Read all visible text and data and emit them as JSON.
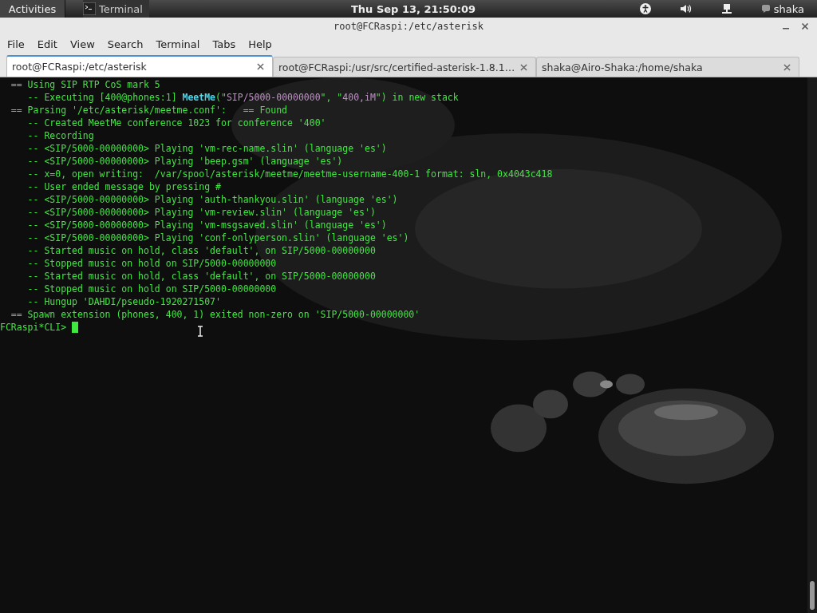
{
  "top_bar": {
    "activities": "Activities",
    "app": "Terminal",
    "clock": "Thu Sep 13, 21:50:09",
    "user": "shaka"
  },
  "window": {
    "title": "root@FCRaspi:/etc/asterisk"
  },
  "menu": [
    "File",
    "Edit",
    "View",
    "Search",
    "Terminal",
    "Tabs",
    "Help"
  ],
  "tabs": [
    {
      "label": "root@FCRaspi:/etc/asterisk",
      "selected": true
    },
    {
      "label": "root@FCRaspi:/usr/src/certified-asterisk-1.8.1…",
      "selected": false
    },
    {
      "label": "shaka@Airo-Shaka:/home/shaka",
      "selected": false
    }
  ],
  "terminal": {
    "lines": [
      [
        {
          "text": "  == Using SIP RTP CoS mark 5",
          "kind": "plain"
        }
      ],
      [
        {
          "text": "     -- Executing [400@phones:1] ",
          "kind": "plain"
        },
        {
          "text": "MeetMe",
          "kind": "function"
        },
        {
          "text": "(\"",
          "kind": "plain"
        },
        {
          "text": "SIP/5000-00000000",
          "kind": "string"
        },
        {
          "text": "\", \"",
          "kind": "plain"
        },
        {
          "text": "400,iM",
          "kind": "string"
        },
        {
          "text": "\") in new stack",
          "kind": "plain"
        }
      ],
      [
        {
          "text": "  == Parsing '/etc/asterisk/meetme.conf':   == Found",
          "kind": "plain"
        }
      ],
      [
        {
          "text": "     -- Created MeetMe conference 1023 for conference '400'",
          "kind": "plain"
        }
      ],
      [
        {
          "text": "     -- Recording",
          "kind": "plain"
        }
      ],
      [
        {
          "text": "     -- <SIP/5000-00000000> Playing 'vm-rec-name.slin' (language 'es')",
          "kind": "plain"
        }
      ],
      [
        {
          "text": "     -- <SIP/5000-00000000> Playing 'beep.gsm' (language 'es')",
          "kind": "plain"
        }
      ],
      [
        {
          "text": "     -- x=0, open writing:  /var/spool/asterisk/meetme/meetme-username-400-1 format: sln, 0x4043c418",
          "kind": "plain"
        }
      ],
      [
        {
          "text": "     -- User ended message by pressing #",
          "kind": "plain"
        }
      ],
      [
        {
          "text": "     -- <SIP/5000-00000000> Playing 'auth-thankyou.slin' (language 'es')",
          "kind": "plain"
        }
      ],
      [
        {
          "text": "     -- <SIP/5000-00000000> Playing 'vm-review.slin' (language 'es')",
          "kind": "plain"
        }
      ],
      [
        {
          "text": "     -- <SIP/5000-00000000> Playing 'vm-msgsaved.slin' (language 'es')",
          "kind": "plain"
        }
      ],
      [
        {
          "text": "     -- <SIP/5000-00000000> Playing 'conf-onlyperson.slin' (language 'es')",
          "kind": "plain"
        }
      ],
      [
        {
          "text": "     -- Started music on hold, class 'default', on SIP/5000-00000000",
          "kind": "plain"
        }
      ],
      [
        {
          "text": "     -- Stopped music on hold on SIP/5000-00000000",
          "kind": "plain"
        }
      ],
      [
        {
          "text": "     -- Started music on hold, class 'default', on SIP/5000-00000000",
          "kind": "plain"
        }
      ],
      [
        {
          "text": "     -- Stopped music on hold on SIP/5000-00000000",
          "kind": "plain"
        }
      ],
      [
        {
          "text": "     -- Hungup 'DAHDI/pseudo-1920271507'",
          "kind": "plain"
        }
      ],
      [
        {
          "text": "  == Spawn extension (phones, 400, 1) exited non-zero on 'SIP/5000-00000000'",
          "kind": "plain"
        }
      ]
    ],
    "prompt": "FCRaspi*CLI> "
  }
}
